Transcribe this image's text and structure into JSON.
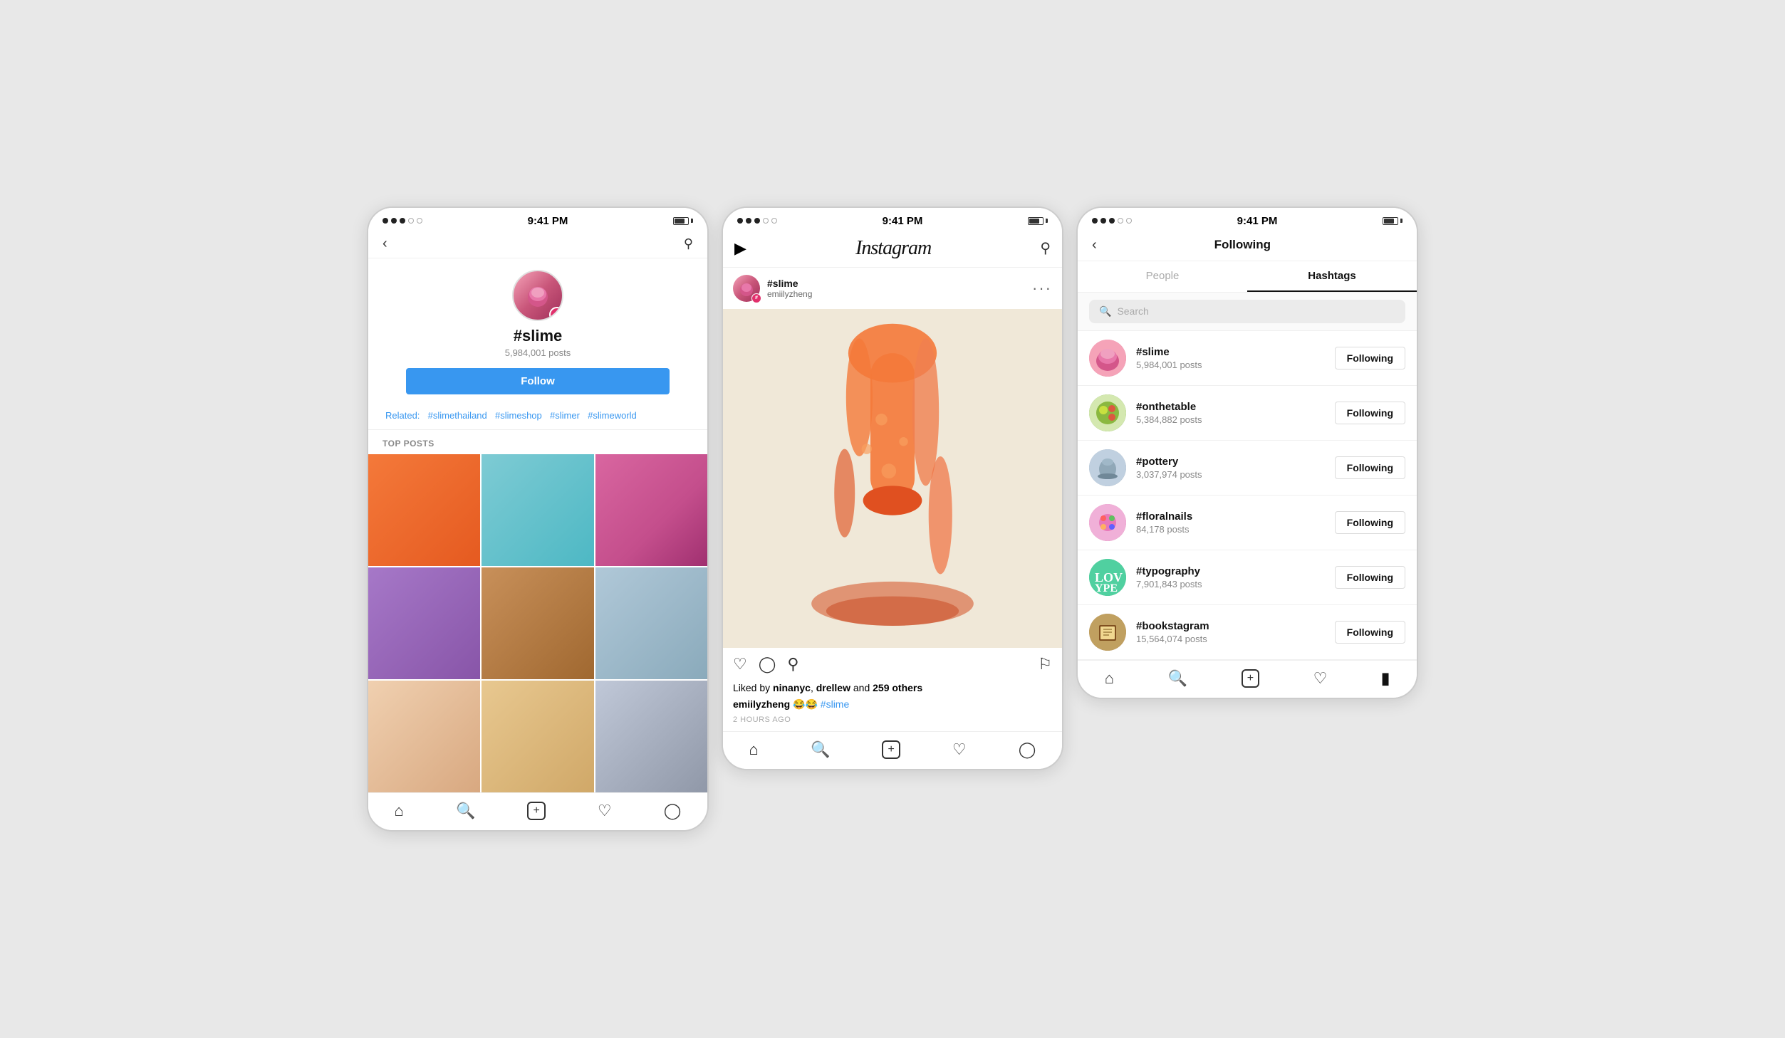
{
  "screen1": {
    "statusBar": {
      "dots": [
        "filled",
        "filled",
        "filled",
        "empty",
        "empty"
      ],
      "time": "9:41 PM",
      "battery": "80%"
    },
    "hashtag": "#slime",
    "posts": "5,984,001 posts",
    "followBtn": "Follow",
    "related": {
      "label": "Related:",
      "tags": [
        "#slimethailand",
        "#slimeshop",
        "#slimer",
        "#slimeworld"
      ]
    },
    "topPostsLabel": "TOP POSTS",
    "grid": [
      {
        "color": "slime-orange"
      },
      {
        "color": "slime-teal"
      },
      {
        "color": "slime-pink"
      },
      {
        "color": "slime-purple"
      },
      {
        "color": "slime-brown"
      },
      {
        "color": "slime-blue-hand"
      },
      {
        "color": "slime-hand"
      },
      {
        "color": "slime-beige"
      },
      {
        "color": "slime-silver"
      }
    ],
    "bottomNav": [
      "home",
      "search",
      "add",
      "heart",
      "person"
    ]
  },
  "screen2": {
    "statusBar": {
      "time": "9:41 PM"
    },
    "header": {
      "logo": "Instagram",
      "sendIcon": "▷"
    },
    "post": {
      "username": "#slime",
      "subUsername": "emiilyzheng",
      "likes": "Liked by ninanyc, drellew and 259 others",
      "caption": "emiilyzheng 😂😂 #slime",
      "time": "2 HOURS AGO"
    },
    "bottomNav": [
      "home-filled",
      "search",
      "add",
      "heart",
      "person"
    ]
  },
  "screen3": {
    "statusBar": {
      "time": "9:41 PM"
    },
    "title": "Following",
    "tabs": [
      {
        "label": "People",
        "active": false
      },
      {
        "label": "Hashtags",
        "active": true
      }
    ],
    "searchPlaceholder": "Search",
    "hashtags": [
      {
        "name": "#slime",
        "posts": "5,984,001 posts",
        "avatarClass": "av-slime",
        "btnLabel": "Following"
      },
      {
        "name": "#onthetable",
        "posts": "5,384,882 posts",
        "avatarClass": "av-food",
        "btnLabel": "Following"
      },
      {
        "name": "#pottery",
        "posts": "3,037,974 posts",
        "avatarClass": "av-pottery",
        "btnLabel": "Following"
      },
      {
        "name": "#floralnails",
        "posts": "84,178 posts",
        "avatarClass": "av-nails",
        "btnLabel": "Following"
      },
      {
        "name": "#typography",
        "posts": "7,901,843 posts",
        "avatarClass": "av-typo",
        "btnLabel": "Following"
      },
      {
        "name": "#bookstagram",
        "posts": "15,564,074 posts",
        "avatarClass": "av-book",
        "btnLabel": "Following"
      }
    ],
    "bottomNav": [
      "home",
      "search",
      "add",
      "heart",
      "person-filled"
    ]
  }
}
